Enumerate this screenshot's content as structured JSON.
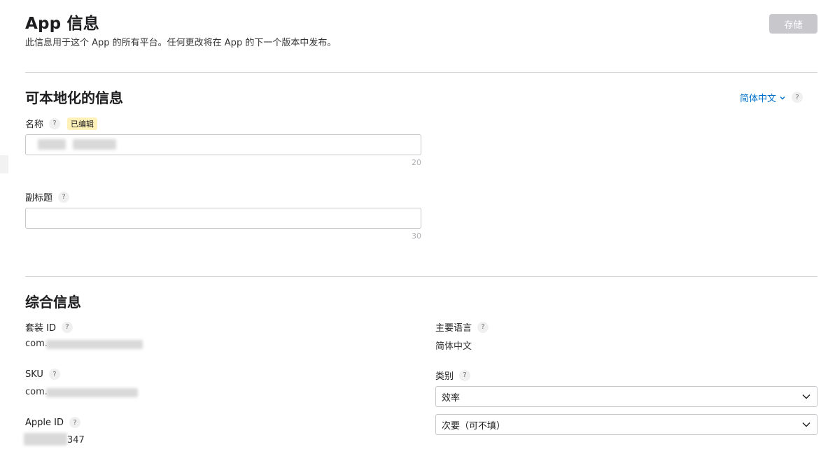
{
  "header": {
    "title": "App 信息",
    "subtitle": "此信息用于这个 App 的所有平台。任何更改将在 App 的下一个版本中发布。",
    "save_label": "存储"
  },
  "localized": {
    "section_title": "可本地化的信息",
    "language_label": "简体中文",
    "name": {
      "label": "名称",
      "badge": "已编辑",
      "value": "",
      "counter": "20"
    },
    "subtitle": {
      "label": "副标题",
      "value": "",
      "counter": "30"
    }
  },
  "general": {
    "section_title": "综合信息",
    "bundle_id": {
      "label": "套装 ID",
      "value_prefix": "com."
    },
    "sku": {
      "label": "SKU",
      "value_prefix": "com."
    },
    "apple_id": {
      "label": "Apple ID",
      "value_suffix": "347"
    },
    "primary_language": {
      "label": "主要语言",
      "value": "简体中文"
    },
    "category": {
      "label": "类别",
      "primary": "效率",
      "secondary": "次要（可不填）"
    }
  },
  "help_glyph": "?",
  "icons": [
    "help-icon",
    "chevron-down-icon"
  ],
  "colors": {
    "link": "#0070c9",
    "save_disabled": "#c7c7cc",
    "badge_bg": "#fff1b8",
    "divider": "#d2d2d7"
  }
}
